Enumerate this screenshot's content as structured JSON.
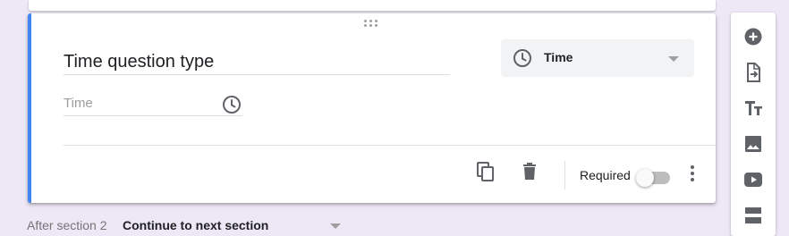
{
  "question": {
    "title": "Time question type",
    "answer_placeholder": "Time",
    "type_select": {
      "selected": "Time",
      "icon": "clock-icon"
    }
  },
  "footer": {
    "required_label": "Required",
    "required_on": false,
    "icons": [
      "duplicate-icon",
      "delete-icon",
      "more-vert-icon"
    ]
  },
  "section_nav": {
    "label": "After section 2",
    "selected": "Continue to next section"
  },
  "toolbar": {
    "items": [
      "add-question-icon",
      "import-questions-icon",
      "add-title-icon",
      "add-image-icon",
      "add-video-icon",
      "add-section-icon"
    ]
  },
  "colors": {
    "accent": "#4285f4",
    "background": "#ede7f6",
    "icon": "#5f6368"
  }
}
